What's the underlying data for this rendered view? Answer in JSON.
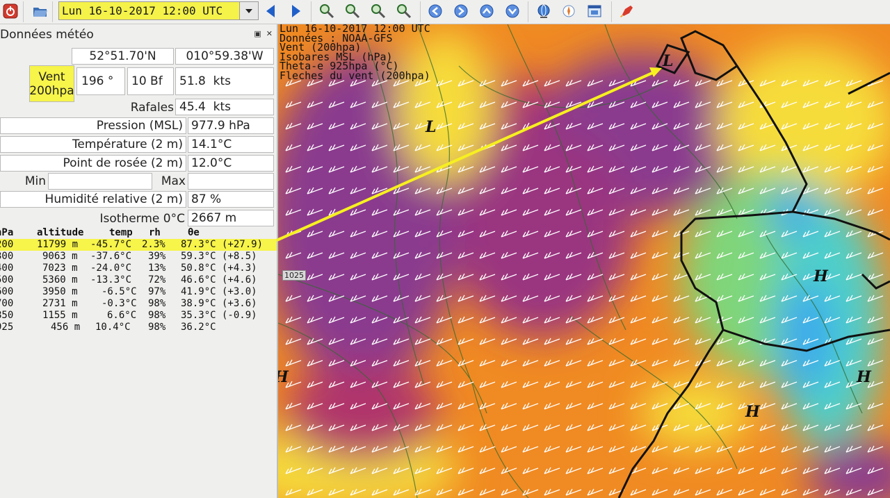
{
  "toolbar": {
    "date_value": "Lun 16-10-2017 12:00 UTC",
    "icons": [
      "power-icon",
      "folder-open-icon",
      "prev-triangle-icon",
      "next-triangle-icon",
      "zoom-in-icon",
      "zoom-out-icon",
      "zoom-selection-icon",
      "zoom-all-icon",
      "arrow-left-icon",
      "arrow-right-icon",
      "arrow-up-icon",
      "arrow-down-icon",
      "globe-icon",
      "compass-icon",
      "window-icon",
      "rocket-icon"
    ]
  },
  "panel": {
    "title": "Données météo",
    "position": {
      "lat": "52°51.70'N",
      "lon": "010°59.38'W"
    },
    "wind": {
      "label": "Vent 200hpa",
      "direction": "196 °",
      "beaufort": "10 Bf",
      "speed": "51.8  kts"
    },
    "rows": [
      {
        "label": "Rafales",
        "value": "45.4  kts"
      },
      {
        "label": "Pression (MSL)",
        "value": "977.9 hPa"
      },
      {
        "label": "Température (2 m)",
        "value": "14.1°C"
      },
      {
        "label": "Point de rosée (2 m)",
        "value": "12.0°C"
      }
    ],
    "minmax": {
      "min_label": "Min",
      "min_value": "",
      "max_label": "Max",
      "max_value": ""
    },
    "rows2": [
      {
        "label": "Humidité relative (2 m)",
        "value": "87 %"
      },
      {
        "label": "Isotherme 0°C",
        "value": "2667 m"
      }
    ]
  },
  "sounding": {
    "headers": [
      "hPa",
      "altitude",
      "temp",
      "rh",
      "θe"
    ],
    "rows": [
      {
        "hpa": "200",
        "alt": "11799 m",
        "temp": "-45.7°C",
        "rh": "2.3%",
        "te": "87.3°C (+27.9)"
      },
      {
        "hpa": "300",
        "alt": "9063 m",
        "temp": "-37.6°C",
        "rh": "39%",
        "te": "59.3°C (+8.5)"
      },
      {
        "hpa": "400",
        "alt": "7023 m",
        "temp": "-24.0°C",
        "rh": "13%",
        "te": "50.8°C (+4.3)"
      },
      {
        "hpa": "500",
        "alt": "5360 m",
        "temp": "-13.3°C",
        "rh": "72%",
        "te": "46.6°C (+4.6)"
      },
      {
        "hpa": "600",
        "alt": "3950 m",
        "temp": "-6.5°C",
        "rh": "97%",
        "te": "41.9°C (+3.0)"
      },
      {
        "hpa": "700",
        "alt": "2731 m",
        "temp": "-0.3°C",
        "rh": "98%",
        "te": "38.9°C (+3.6)"
      },
      {
        "hpa": "850",
        "alt": "1155 m",
        "temp": "6.6°C",
        "rh": "98%",
        "te": "35.3°C (-0.9)"
      },
      {
        "hpa": "925",
        "alt": "456 m",
        "temp": "10.4°C",
        "rh": "98%",
        "te": "36.2°C"
      }
    ]
  },
  "map": {
    "header_lines": [
      "Lun 16-10-2017 12:00 UTC",
      "Données : NOAA-GFS",
      "Vent (200hpa)",
      "Isobares MSL (hPa)",
      "Theta-e 925hpa (°C)",
      "Fleches du vent (200hpa)"
    ],
    "pressure_labels": [
      "L",
      "L",
      "H",
      "H",
      "H",
      "H"
    ],
    "isobar_value": "1025",
    "colors": {
      "purple": "#8a3a8e",
      "magenta": "#b0346a",
      "orange": "#f08a22",
      "yellow": "#f6dc3a",
      "green": "#7fd67a",
      "cyan": "#4fd0c8",
      "blue": "#3aa8ee",
      "highlight": "#f7f44a"
    }
  }
}
